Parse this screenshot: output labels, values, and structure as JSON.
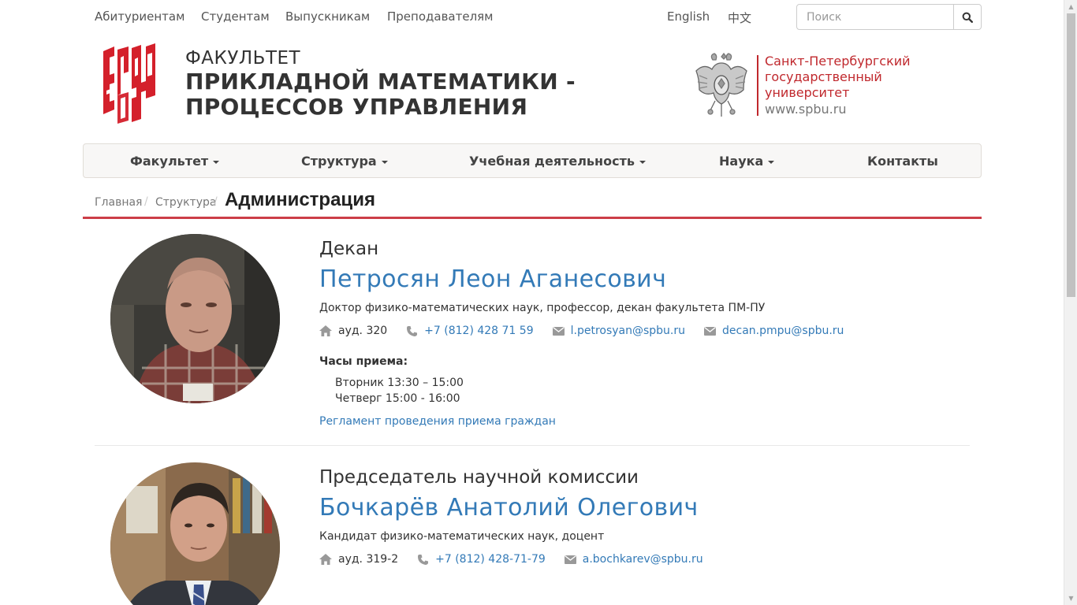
{
  "topnav": {
    "links": [
      "Абитуриентам",
      "Студентам",
      "Выпускникам",
      "Преподавателям"
    ],
    "lang_en": "English",
    "lang_zh": "中文",
    "search_placeholder": "Поиск"
  },
  "header": {
    "faculty_label": "ФАКУЛЬТЕТ",
    "faculty_line1": "ПРИКЛАДНОЙ МАТЕМАТИКИ -",
    "faculty_line2": "ПРОЦЕССОВ УПРАВЛЕНИЯ",
    "university_line1": "Санкт-Петербургский",
    "university_line2": "государственный",
    "university_line3": "университет",
    "university_url": "www.spbu.ru"
  },
  "mainnav": {
    "items": [
      "Факультет",
      "Структура",
      "Учебная деятельность",
      "Наука",
      "Контакты"
    ]
  },
  "breadcrumb": {
    "home": "Главная",
    "section": "Структура",
    "current": "Администрация"
  },
  "people": [
    {
      "role": "Декан",
      "name": "Петросян Леон Аганесович",
      "degree": "Доктор физико-математических наук, профессор, декан факультета ПМ-ПУ",
      "room": "ауд. 320",
      "phone": "+7 (812) 428 71 59",
      "emails": [
        "l.petrosyan@spbu.ru",
        "decan.pmpu@spbu.ru"
      ],
      "hours_title": "Часы приема:",
      "hours": [
        "Вторник 13:30 – 15:00",
        "Четверг 15:00 - 16:00"
      ],
      "regulation_link": "Регламент проведения приема граждан"
    },
    {
      "role": "Председатель научной комиссии",
      "name": "Бочкарёв Анатолий Олегович",
      "degree": "Кандидат физико-математических наук, доцент",
      "room": "ауд. 319-2",
      "phone": "+7 (812) 428-71-79",
      "emails": [
        "a.bochkarev@spbu.ru"
      ]
    }
  ],
  "colors": {
    "accent_red": "#c0282d",
    "link_blue": "#337ab7",
    "breadcrumb_rule": "#cc3e48"
  }
}
